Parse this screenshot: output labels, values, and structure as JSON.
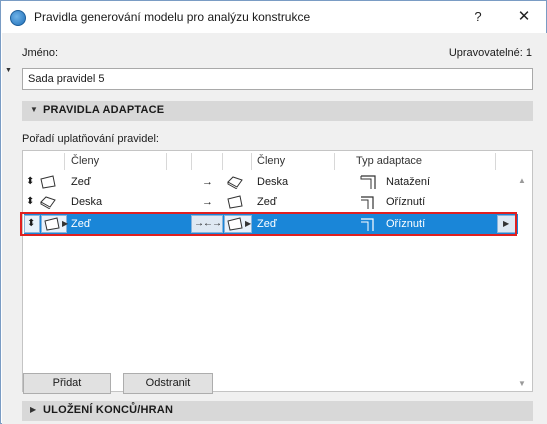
{
  "window": {
    "title": "Pravidla generování modelu pro analýzu konstrukce",
    "help": "?",
    "close": "✕"
  },
  "name": {
    "label": "Jméno:",
    "editable_label": "Upravovatelné: 1",
    "value": "Sada pravidel 5"
  },
  "adaptation": {
    "section_title": "PRAVIDLA ADAPTACE",
    "order_label": "Pořadí uplatňování pravidel:",
    "headers": {
      "members_left": "Členy",
      "members_right": "Členy",
      "adaptation_type": "Typ adaptace"
    },
    "rows": [
      {
        "left_member": "Zeď",
        "right_member": "Deska",
        "adaptation": "Natažení",
        "selected": false
      },
      {
        "left_member": "Deska",
        "right_member": "Zeď",
        "adaptation": "Oříznutí",
        "selected": false
      },
      {
        "left_member": "Zeď",
        "right_member": "Zeď",
        "adaptation": "Oříznutí",
        "selected": true
      }
    ]
  },
  "buttons": {
    "add": "Přidat",
    "remove": "Odstranit"
  },
  "endings": {
    "section_title": "ULOŽENÍ KONCŮ/HRAN"
  },
  "colors": {
    "selection": "#1a86d8",
    "highlight_border": "#e02020"
  },
  "icons": {
    "app": "archicad-app-icon",
    "reorder": "updown-arrows-icon",
    "wall": "wall-icon",
    "slab": "slab-icon",
    "arrow": "right-arrow-icon",
    "extend": "extend-icon",
    "trim": "trim-icon"
  }
}
